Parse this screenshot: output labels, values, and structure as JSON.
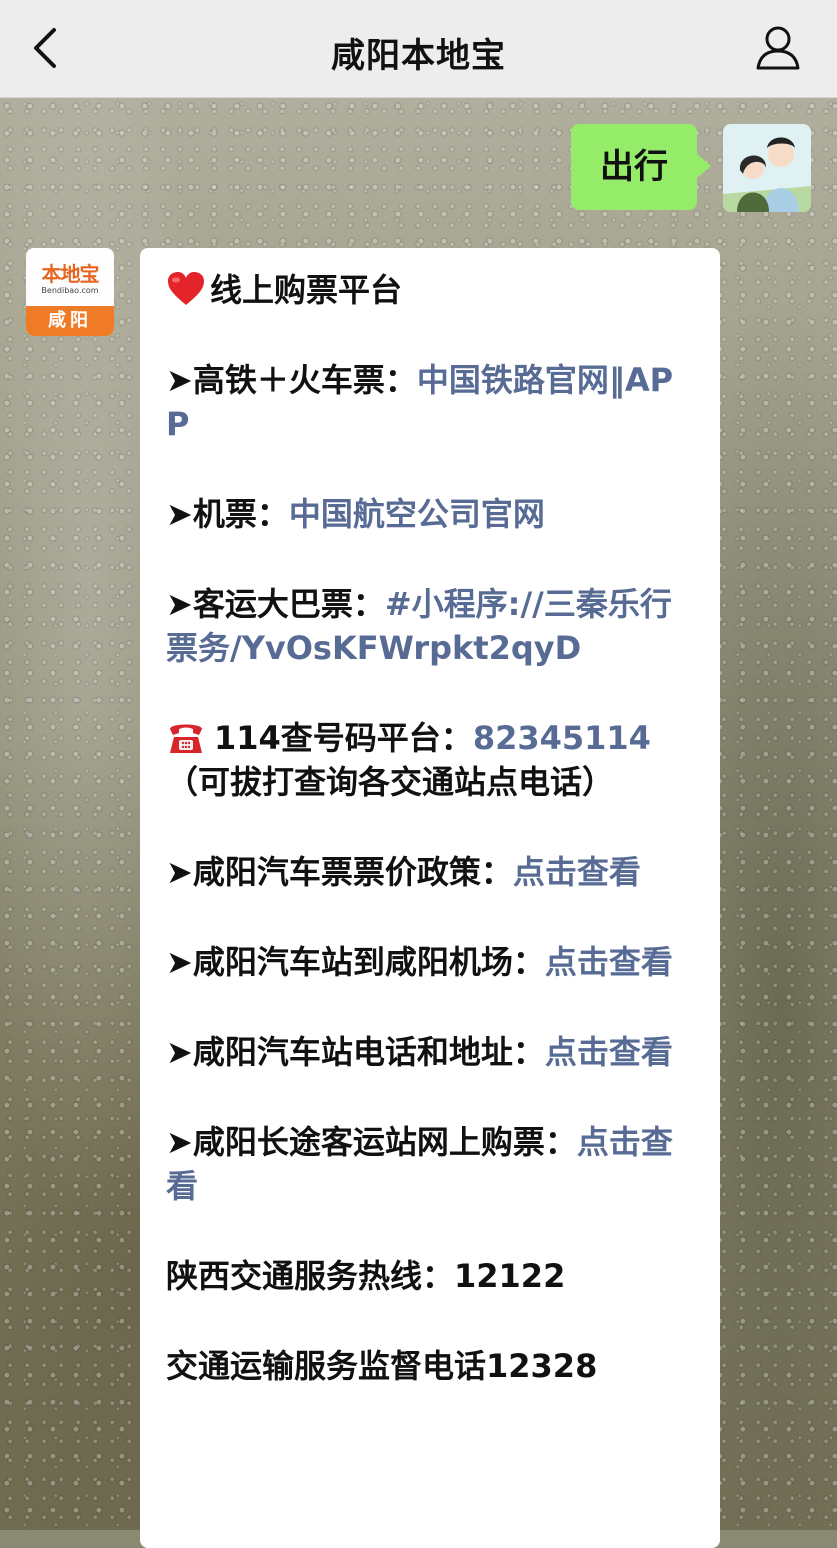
{
  "navbar": {
    "title": "咸阳本地宝",
    "back_icon": "chevron-left-icon",
    "profile_icon": "person-icon"
  },
  "my_message": {
    "text": "出行"
  },
  "bot": {
    "avatar_brand": "本地宝",
    "avatar_domain": "Bendibao.com",
    "avatar_city": "咸阳"
  },
  "message": {
    "heading": "线上购票平台",
    "items": [
      {
        "label": "➤高铁＋火车票：",
        "link": "中国铁路官网‖APP"
      },
      {
        "label": "➤机票：",
        "link": "中国航空公司官网"
      },
      {
        "label": "➤客运大巴票：",
        "link": "#小程序://三秦乐行票务/YvOsKFWrpkt2qyD"
      },
      {
        "label": "114查号码平台：",
        "link": "82345114",
        "note": "（可拔打查询各交通站点电话）"
      },
      {
        "label": "➤咸阳汽车票票价政策：",
        "link": "点击查看"
      },
      {
        "label": "➤咸阳汽车站到咸阳机场：",
        "link": "点击查看"
      },
      {
        "label": "➤咸阳汽车站电话和地址：",
        "link": "点击查看"
      },
      {
        "label": "➤咸阳长途客运站网上购票：",
        "link": "点击查看"
      },
      {
        "label": "陕西交通服务热线：12122"
      },
      {
        "label": "交通运输服务监督电话12328"
      }
    ]
  },
  "colors": {
    "link": "#576b95",
    "my_bubble": "#95ec69",
    "navbar": "#ededed",
    "brand_orange": "#f07b26"
  }
}
